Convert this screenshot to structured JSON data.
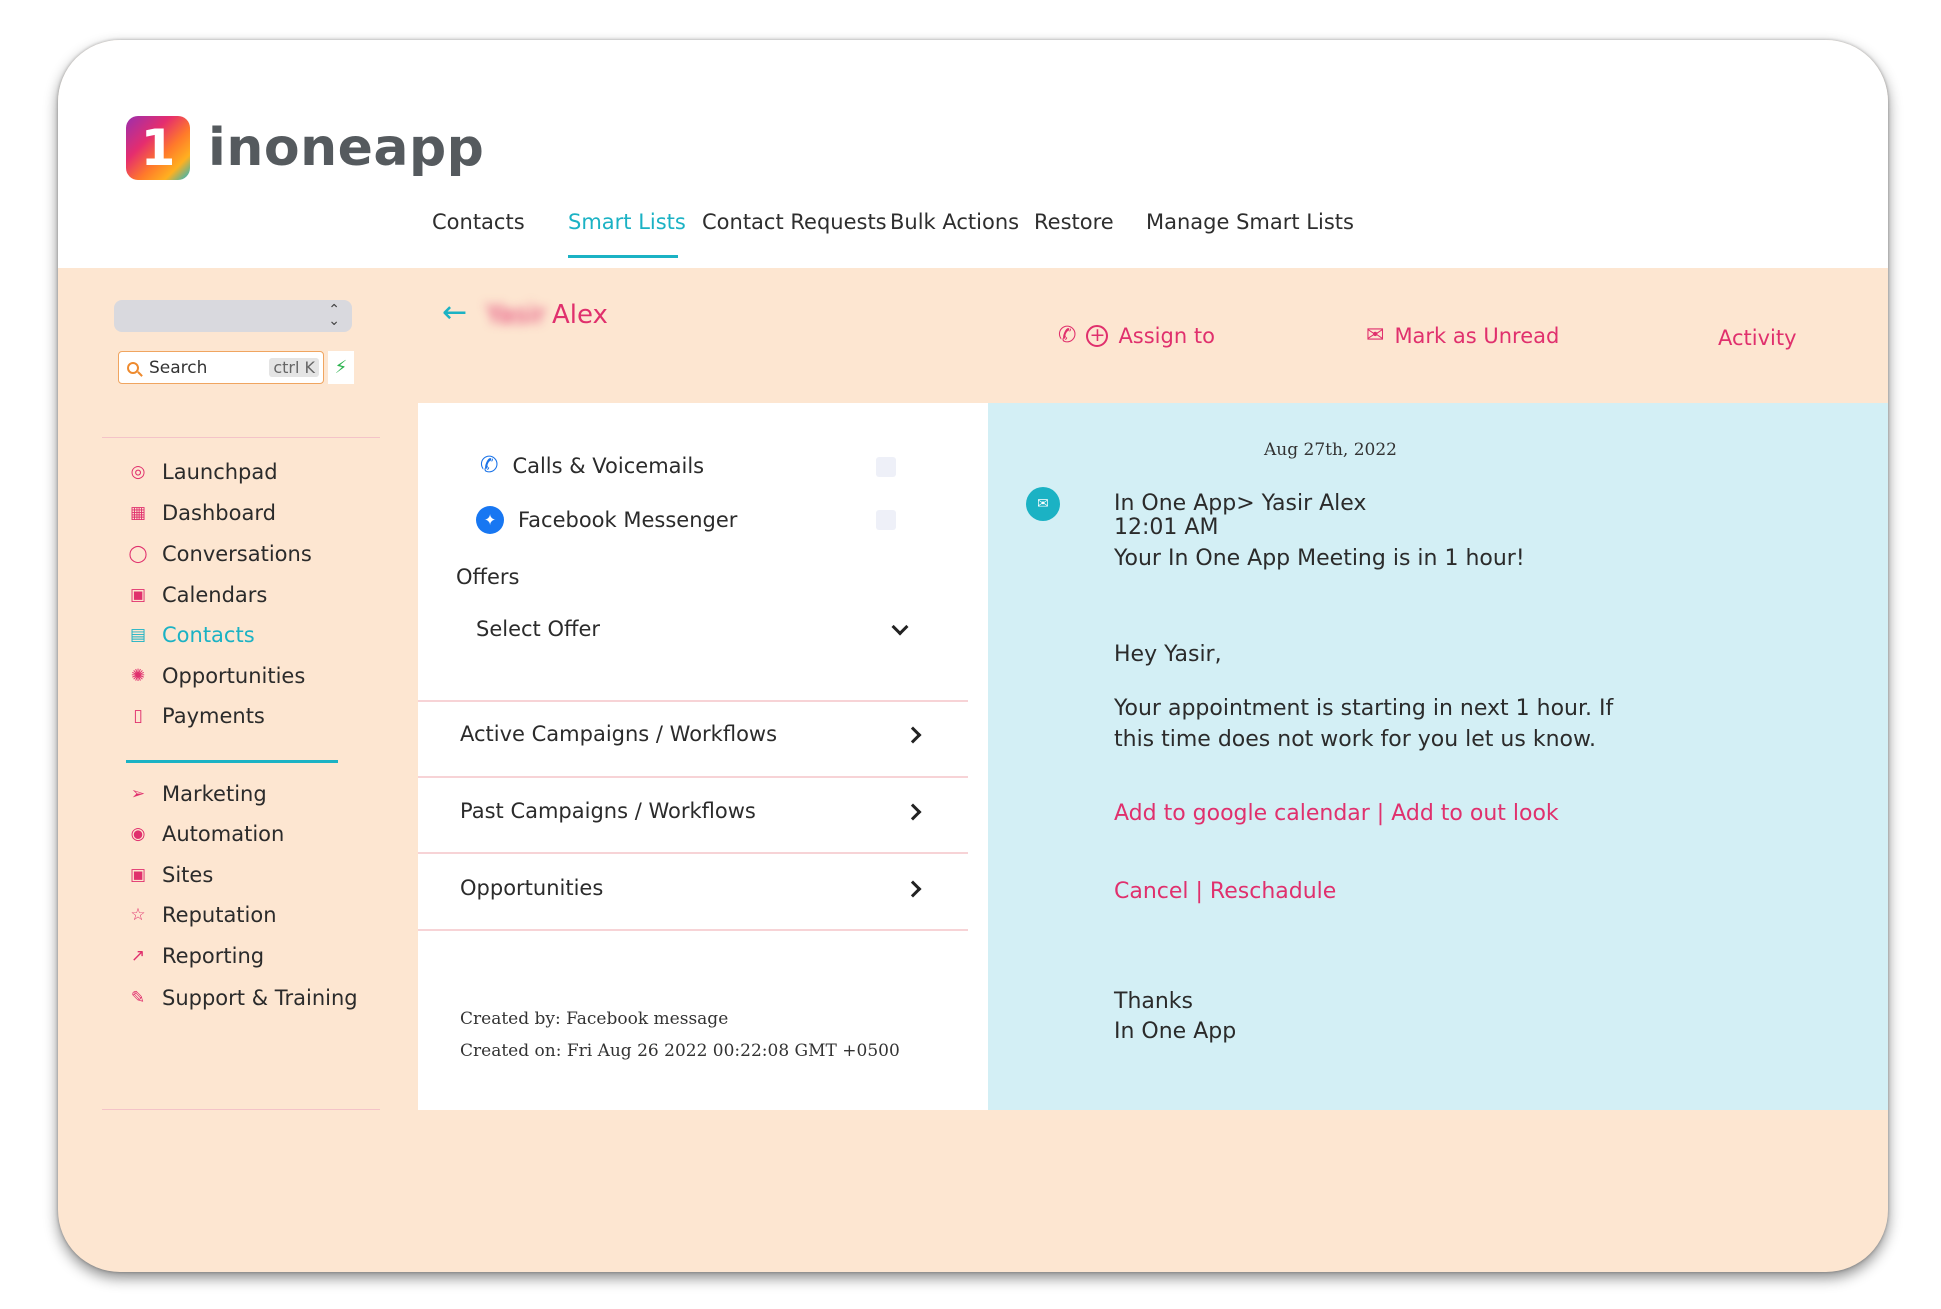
{
  "brand": {
    "name": "inoneapp",
    "mark": "1"
  },
  "nav": {
    "tabs": [
      {
        "label": "Contacts"
      },
      {
        "label": "Smart Lists",
        "active": true
      },
      {
        "label": "Contact Requests"
      },
      {
        "label": "Bulk Actions"
      },
      {
        "label": "Restore"
      },
      {
        "label": "Manage Smart Lists"
      }
    ]
  },
  "sidebar": {
    "search_placeholder": "Search",
    "search_shortcut": "ctrl K",
    "items": [
      {
        "label": "Launchpad",
        "icon": "launchpad-icon"
      },
      {
        "label": "Dashboard",
        "icon": "dashboard-grid-icon"
      },
      {
        "label": "Conversations",
        "icon": "chat-bubble-icon"
      },
      {
        "label": "Calendars",
        "icon": "calendar-icon"
      },
      {
        "label": "Contacts",
        "icon": "contacts-icon",
        "active": true
      },
      {
        "label": "Opportunities",
        "icon": "opportunities-icon"
      },
      {
        "label": "Payments",
        "icon": "payments-icon"
      },
      {
        "label": "Marketing",
        "icon": "send-icon"
      },
      {
        "label": "Automation",
        "icon": "automation-icon"
      },
      {
        "label": "Sites",
        "icon": "sites-icon"
      },
      {
        "label": "Reputation",
        "icon": "star-icon"
      },
      {
        "label": "Reporting",
        "icon": "trend-icon"
      },
      {
        "label": "Support & Training",
        "icon": "wrench-icon"
      }
    ]
  },
  "contact": {
    "first_name": "Yasir",
    "last_name": "Alex"
  },
  "actions": {
    "assign": "Assign to",
    "mark_unread": "Mark as Unread",
    "activity": "Activity"
  },
  "middle": {
    "channels": [
      {
        "label": "Calls & Voicemails",
        "icon": "phone-icon"
      },
      {
        "label": "Facebook Messenger",
        "icon": "messenger-icon"
      }
    ],
    "offers_label": "Offers",
    "offer_select": "Select Offer",
    "sections": [
      {
        "label": "Active Campaigns / Workflows"
      },
      {
        "label": "Past Campaigns / Workflows"
      },
      {
        "label": "Opportunities"
      }
    ],
    "created_by": "Created by: Facebook message",
    "created_on": "Created on: Fri Aug 26 2022 00:22:08 GMT +0500"
  },
  "message": {
    "date": "Aug 27th, 2022",
    "from": "In One App> Yasir Alex",
    "time": "12:01 AM",
    "subject": "Your In One App Meeting is in 1 hour!",
    "greeting": "Hey Yasir,",
    "body_line1": "Your appointment is starting in next 1 hour. If",
    "body_line2": "this time does not work for you let us know.",
    "calendar_links": "Add to google calendar | Add to out look",
    "manage_links": "Cancel | Reschadule",
    "signoff": "Thanks",
    "signature": "In One App"
  },
  "colors": {
    "accent_teal": "#1bb2c4",
    "accent_pink": "#e0306d",
    "background_peach": "#fde6d1",
    "message_panel": "#d3eff5"
  }
}
